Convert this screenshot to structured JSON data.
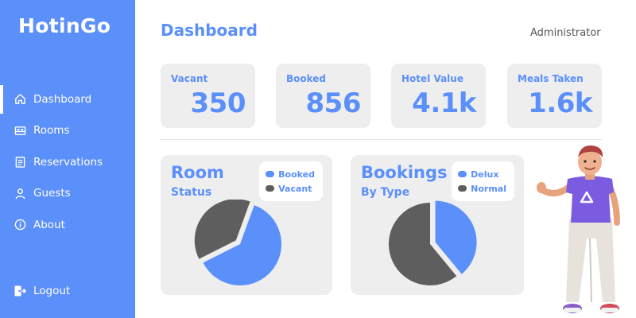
{
  "app": {
    "brand": "HotinGo"
  },
  "sidebar": {
    "items": [
      {
        "label": "Dashboard",
        "icon": "home-icon",
        "active": true
      },
      {
        "label": "Rooms",
        "icon": "bed-icon",
        "active": false
      },
      {
        "label": "Reservations",
        "icon": "clipboard-icon",
        "active": false
      },
      {
        "label": "Guests",
        "icon": "user-icon",
        "active": false
      },
      {
        "label": "About",
        "icon": "info-icon",
        "active": false
      }
    ],
    "logout": {
      "label": "Logout",
      "icon": "logout-icon"
    }
  },
  "header": {
    "title": "Dashboard",
    "user_role": "Administrator"
  },
  "stats": [
    {
      "label": "Vacant",
      "value": "350"
    },
    {
      "label": "Booked",
      "value": "856"
    },
    {
      "label": "Hotel Value",
      "value": "4.1k"
    },
    {
      "label": "Meals Taken",
      "value": "1.6k"
    }
  ],
  "colors": {
    "accent": "#5b8ff9",
    "secondary": "#5e5e5e",
    "card": "#eeeeee",
    "sidebar": "#5b8ff9"
  },
  "chart_data": [
    {
      "type": "pie",
      "title": "Room",
      "subtitle": "Status",
      "legend": [
        "Booked",
        "Vacant"
      ],
      "legend_position": "top-right",
      "slices": [
        {
          "name": "Booked",
          "value": 62,
          "color": "#5b8ff9"
        },
        {
          "name": "Vacant",
          "value": 38,
          "color": "#5e5e5e"
        }
      ],
      "exploded": "Vacant"
    },
    {
      "type": "pie",
      "title": "Bookings",
      "subtitle": "By Type",
      "legend": [
        "Delux",
        "Normal"
      ],
      "legend_position": "top-right",
      "slices": [
        {
          "name": "Delux",
          "value": 39,
          "color": "#5b8ff9"
        },
        {
          "name": "Normal",
          "value": 61,
          "color": "#5e5e5e"
        }
      ],
      "exploded": "Delux"
    }
  ]
}
